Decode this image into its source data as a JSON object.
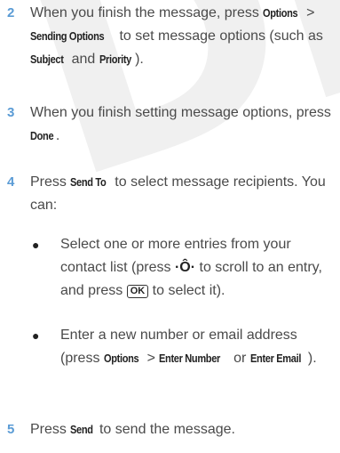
{
  "watermark": "DRA",
  "steps": [
    {
      "num": "2",
      "p1": "When you finish the message, press ",
      "k1": "Options",
      "p2": " > ",
      "k2": "Sending Options",
      "p3": " to set message options (such as ",
      "k3": "Subject",
      "p4": " and ",
      "k4": "Priority",
      "p5": ")."
    },
    {
      "num": "3",
      "p1": "When you finish setting message options, press ",
      "k1": "Done",
      "p2": "."
    },
    {
      "num": "4",
      "p1": "Press ",
      "k1": "Send To",
      "p2": " to select message recipients. You can:"
    },
    {
      "num": "5",
      "p1": "Press ",
      "k1": "Send",
      "p2": " to send the message."
    }
  ],
  "bullets": [
    {
      "p1": "Select one or more entries from your contact list (press ",
      "icon1": "·Ô·",
      "p2": " to scroll to an entry, and press ",
      "icon2": "OK",
      "p3": " to select it)."
    },
    {
      "p1": "Enter a new number or email address (press ",
      "k1": "Options",
      "p2": " > ",
      "k2": "Enter Number",
      "p3": " or ",
      "k3": "Enter Email",
      "p4": ")."
    }
  ],
  "icons": {
    "nav": "nav-key-icon",
    "ok": "ok-key-icon"
  },
  "colors": {
    "step_number": "#5a9bd5",
    "body_text": "#4a4a4a",
    "watermark": "#f0f0f0"
  }
}
